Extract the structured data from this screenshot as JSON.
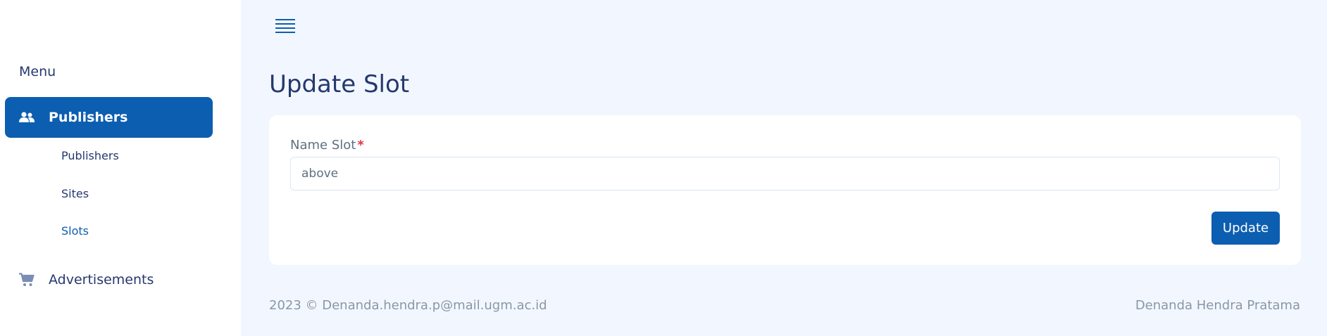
{
  "sidebar": {
    "menu_title": "Menu",
    "active_item": {
      "label": "Publishers",
      "icon": "users-icon"
    },
    "sub_items": [
      {
        "label": "Publishers",
        "active": false
      },
      {
        "label": "Sites",
        "active": false
      },
      {
        "label": "Slots",
        "active": true
      }
    ],
    "items": [
      {
        "label": "Advertisements",
        "icon": "cart-icon"
      }
    ]
  },
  "header": {
    "menu_toggle_icon": "hamburger-icon"
  },
  "main": {
    "title": "Update Slot",
    "form": {
      "name_label": "Name Slot",
      "required_marker": "*",
      "name_value": "above",
      "submit_label": "Update"
    }
  },
  "footer": {
    "left": "2023 © Denanda.hendra.p@mail.ugm.ac.id",
    "right": "Denanda Hendra Pratama"
  },
  "colors": {
    "primary": "#0c5eb0",
    "background": "#f2f7ff",
    "text_dark": "#25396f",
    "required": "#dc3545"
  }
}
